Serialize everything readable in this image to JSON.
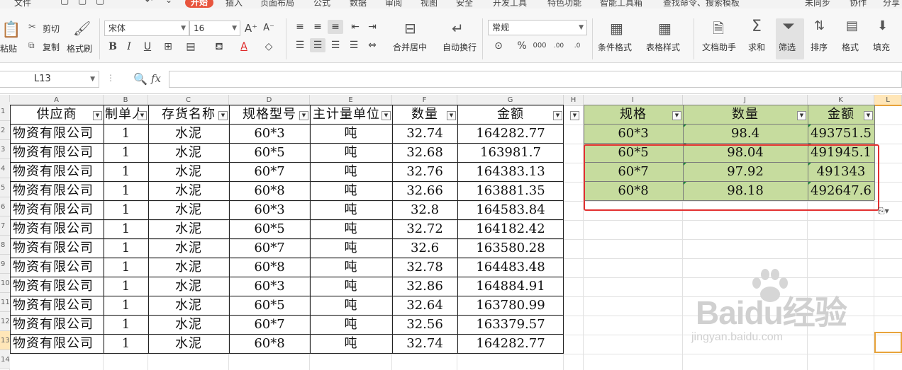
{
  "menu": {
    "items": [
      "文件",
      "开始",
      "插入",
      "页面布局",
      "公式",
      "数据",
      "审阅",
      "视图",
      "安全",
      "开发工具",
      "特色功能",
      "智能工具箱",
      "查找命令、搜索模板",
      "未同步",
      "协作",
      "分享"
    ],
    "active": "开始"
  },
  "ribbon": {
    "paste": "粘贴",
    "cut": "剪切",
    "copy": "复制",
    "format_painter": "格式刷",
    "font_name": "宋体",
    "font_size": "16",
    "merge_center": "合并居中",
    "wrap_text": "自动换行",
    "number_format": "常规",
    "conditional_format": "条件格式",
    "table_style": "表格样式",
    "doc_assistant": "文档助手",
    "sum": "求和",
    "filter": "筛选",
    "sort": "排序",
    "format": "格式",
    "fill": "填充"
  },
  "formula_bar": {
    "cell_ref": "L13",
    "fx": "fx",
    "formula": ""
  },
  "columns": [
    "A",
    "B",
    "C",
    "D",
    "E",
    "F",
    "G",
    "H",
    "I",
    "J",
    "K",
    "L"
  ],
  "row_numbers": [
    "1",
    "2",
    "3",
    "4",
    "5",
    "6",
    "7",
    "8",
    "9",
    "10",
    "11",
    "12",
    "13",
    "14"
  ],
  "table": {
    "headers": [
      "供应商",
      "制单人",
      "存货名称",
      "规格型号",
      "主计量单位",
      "数量",
      "金额"
    ],
    "rows": [
      [
        "物资有限公司",
        "1",
        "水泥",
        "60*3",
        "吨",
        "32.74",
        "164282.77"
      ],
      [
        "物资有限公司",
        "1",
        "水泥",
        "60*5",
        "吨",
        "32.68",
        "163981.7"
      ],
      [
        "物资有限公司",
        "1",
        "水泥",
        "60*7",
        "吨",
        "32.76",
        "164383.13"
      ],
      [
        "物资有限公司",
        "1",
        "水泥",
        "60*8",
        "吨",
        "32.66",
        "163881.35"
      ],
      [
        "物资有限公司",
        "1",
        "水泥",
        "60*3",
        "吨",
        "32.8",
        "164583.84"
      ],
      [
        "物资有限公司",
        "1",
        "水泥",
        "60*5",
        "吨",
        "32.72",
        "164182.42"
      ],
      [
        "物资有限公司",
        "1",
        "水泥",
        "60*7",
        "吨",
        "32.6",
        "163580.28"
      ],
      [
        "物资有限公司",
        "1",
        "水泥",
        "60*8",
        "吨",
        "32.78",
        "164483.48"
      ],
      [
        "物资有限公司",
        "1",
        "水泥",
        "60*3",
        "吨",
        "32.86",
        "164884.91"
      ],
      [
        "物资有限公司",
        "1",
        "水泥",
        "60*5",
        "吨",
        "32.64",
        "163780.99"
      ],
      [
        "物资有限公司",
        "1",
        "水泥",
        "60*7",
        "吨",
        "32.56",
        "163379.57"
      ],
      [
        "物资有限公司",
        "1",
        "水泥",
        "60*8",
        "吨",
        "32.74",
        "164282.77"
      ]
    ]
  },
  "summary": {
    "headers": [
      "规格",
      "数量",
      "金额"
    ],
    "rows": [
      [
        "60*3",
        "98.4",
        "493751.5"
      ],
      [
        "60*5",
        "98.04",
        "491945.1"
      ],
      [
        "60*7",
        "97.92",
        "491343"
      ],
      [
        "60*8",
        "98.18",
        "492647.6"
      ]
    ],
    "fill_color": "#c6dc9e"
  },
  "watermark": {
    "brand": "Baidu经验",
    "url": "jingyan.baidu.com"
  },
  "colors": {
    "highlight_border": "#e23030",
    "active_cell_border": "#e8a33b",
    "menu_active": "#e8553e"
  }
}
